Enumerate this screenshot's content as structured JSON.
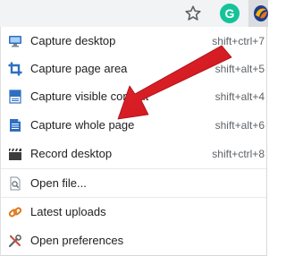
{
  "toolbar": {
    "bookmark_icon": "star-icon",
    "grammarly_icon": "grammarly-icon",
    "grammarly_letter": "G",
    "extension_icon": "screenshot-extension-icon"
  },
  "menu": {
    "items": [
      {
        "label": "Capture desktop",
        "shortcut": "shift+ctrl+7",
        "icon": "monitor-icon"
      },
      {
        "label": "Capture page area",
        "shortcut": "shift+alt+5",
        "icon": "crop-icon"
      },
      {
        "label": "Capture visible content",
        "shortcut": "shift+alt+4",
        "icon": "visible-content-icon"
      },
      {
        "label": "Capture whole page",
        "shortcut": "shift+alt+6",
        "icon": "whole-page-icon"
      },
      {
        "label": "Record desktop",
        "shortcut": "shift+ctrl+8",
        "icon": "clapperboard-icon"
      },
      {
        "label": "Open file...",
        "shortcut": "",
        "icon": "open-file-icon"
      },
      {
        "label": "Latest uploads",
        "shortcut": "",
        "icon": "link-icon"
      },
      {
        "label": "Open preferences",
        "shortcut": "",
        "icon": "tools-icon"
      }
    ]
  },
  "colors": {
    "arrow": "#dd1f26",
    "grammarly": "#15c39a",
    "icon_blue": "#2f6fc1"
  }
}
